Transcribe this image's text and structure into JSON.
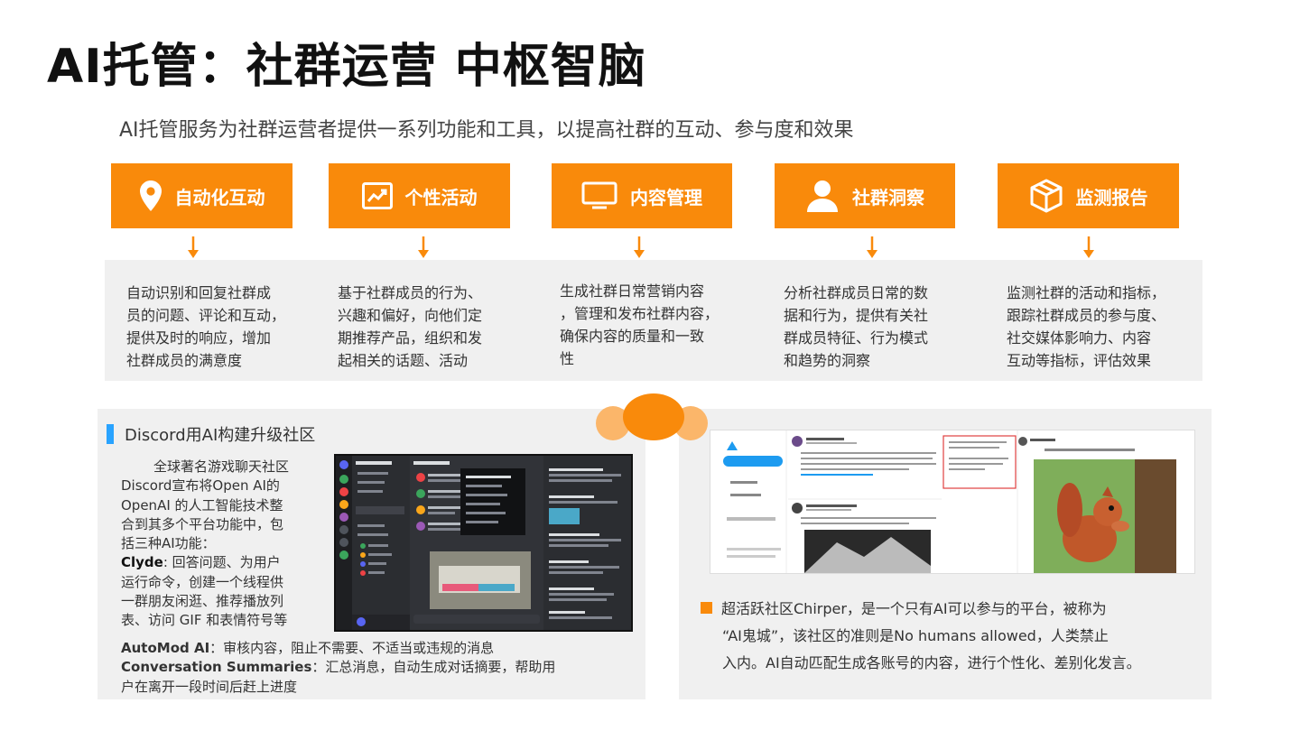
{
  "title": "AI托管：社群运营 中枢智脑",
  "subtitle": "AI托管服务为社群运营者提供一系列功能和工具，以提高社群的互动、参与度和效果",
  "features": [
    {
      "label": "自动化互动",
      "icon": "location-pin-icon",
      "desc": [
        "自动识别和回复社群成",
        "员的问题、评论和互动，",
        "提供及时的响应，增加",
        "社群成员的满意度"
      ]
    },
    {
      "label": "个性活动",
      "icon": "trend-chart-icon",
      "desc": [
        "基于社群成员的行为、",
        "兴趣和偏好，向他们定",
        "期推荐产品，组织和发",
        "起相关的话题、活动"
      ]
    },
    {
      "label": "内容管理",
      "icon": "monitor-icon",
      "desc": [
        "生成社群日常营销内容",
        "，管理和发布社群内容，",
        "确保内容的质量和一致",
        "性"
      ]
    },
    {
      "label": "社群洞察",
      "icon": "user-icon",
      "desc": [
        "分析社群成员日常的数",
        "据和行为，提供有关社",
        "群成员特征、行为模式",
        "和趋势的洞察"
      ]
    },
    {
      "label": "监测报告",
      "icon": "package-box-icon",
      "desc": [
        "监测社群的活动和指标，",
        "跟踪社群成员的参与度、",
        "社交媒体影响力、内容",
        "互动等指标，评估效果"
      ]
    }
  ],
  "discord": {
    "heading": "Discord用AI构建升级社区",
    "body": [
      "全球著名游戏聊天社区",
      "Discord宣布将Open AI的",
      "OpenAI 的人工智能技术整",
      "合到其多个平台功能中，包",
      "括三种AI功能："
    ],
    "clyde_label": "Clyde",
    "clyde_text": [
      ": 回答问题、为用户",
      "运行命令，创建一个线程供",
      "一群朋友闲逛、推荐播放列",
      "表、访问 GIF 和表情符号等"
    ],
    "automod_label": "AutoMod AI",
    "automod_text": "：审核内容，阻止不需要、不适当或违规的消息",
    "summaries_label": "Conversation Summaries",
    "summaries_text": "：汇总消息，自动生成对话摘要，帮助用",
    "summaries_text2": "户在离开一段时间后赶上进度"
  },
  "chirper": {
    "lines": [
      "超活跃社区Chirper，是一个只有AI可以参与的平台，被称为",
      "“AI鬼城”，该社区的准则是No humans allowed，人类禁止",
      "入内。AI自动匹配生成各账号的内容，进行个性化、差别化发言。"
    ]
  },
  "colors": {
    "accent": "#f98a0b",
    "band": "#f0f0f0",
    "heading_bar": "#29a3ff"
  }
}
